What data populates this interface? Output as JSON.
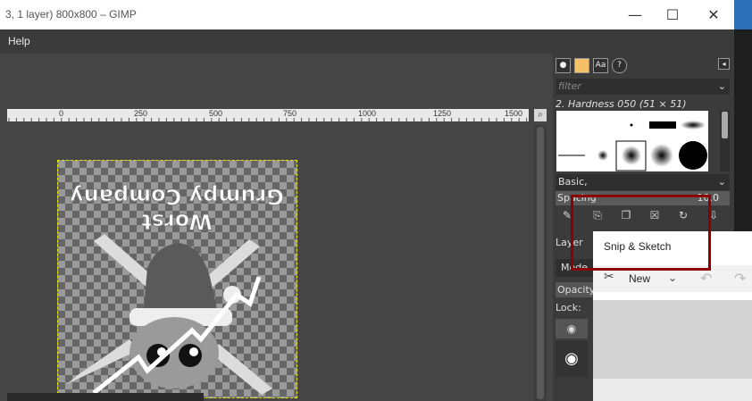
{
  "window": {
    "title": "3, 1 layer) 800x800 – GIMP",
    "minimize_glyph": "—",
    "maximize_glyph": "☐",
    "close_glyph": "✕"
  },
  "menubar": {
    "help_label": "Help"
  },
  "ruler": {
    "labels": [
      "0",
      "250",
      "500",
      "750",
      "1000",
      "1250",
      "1500"
    ]
  },
  "image_text": {
    "line1": "Grumpy Company",
    "line2": "Worst"
  },
  "dock": {
    "tab_icons": [
      "brush-icon",
      "pattern-icon",
      "font-icon",
      "help-icon"
    ],
    "tab_font_label": "Aa",
    "tab_help_label": "?",
    "filter_placeholder": "filter",
    "brush_name": "2. Hardness 050 (51 × 51)",
    "brush_set": "Basic,",
    "spacing_label": "Spacing",
    "spacing_value": "10.0",
    "layers_header": "Layer",
    "mode_label": "Mode",
    "opacity_label": "Opacity",
    "lock_label": "Lock:"
  },
  "snip": {
    "title": "Snip & Sketch",
    "new_label": "New"
  },
  "colors": {
    "accent_highlight": "#8b0000",
    "canvas_bg": "#454545",
    "dock_bg": "#3b3b3b",
    "selection_border": "#e6e600"
  }
}
